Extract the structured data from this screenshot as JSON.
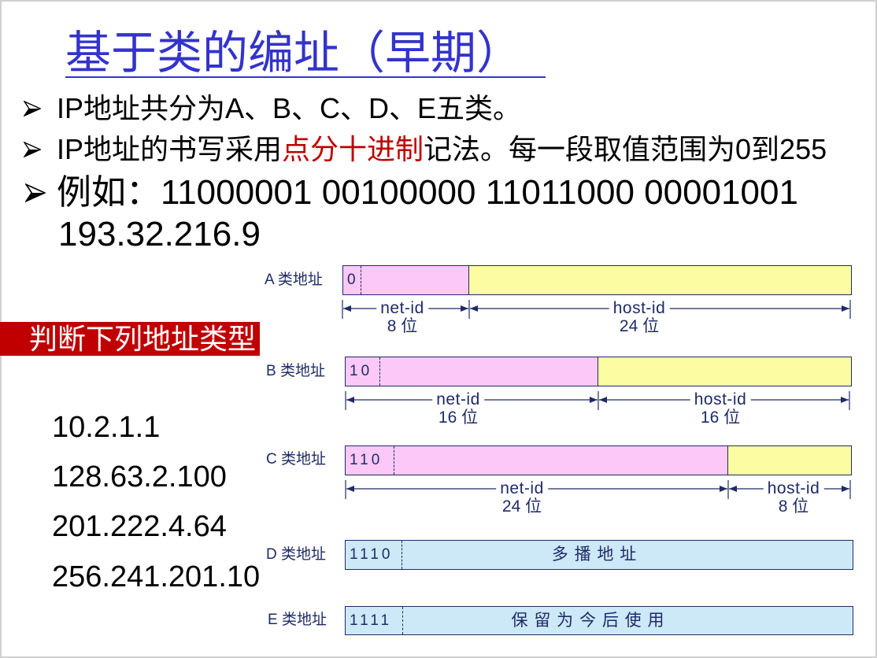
{
  "slide": {
    "title": "基于类的编址（早期）",
    "bullet_icon": "arrowhead-bullet-icon",
    "bullets": [
      {
        "text": "IP地址共分为A、B、C、D、E五类。"
      },
      {
        "text_before": "IP地址的书写采用",
        "highlight": "点分十进制",
        "text_after": "记法。每一段取值范围为0到255"
      },
      {
        "line1": "例如：11000001 00100000 11011000 00001001",
        "line2": "193.32.216.9"
      }
    ]
  },
  "exercise": {
    "banner": "判断下列地址类型",
    "addresses": [
      "10.2.1.1",
      "128.63.2.100",
      "201.222.4.64",
      "256.241.201.10"
    ]
  },
  "address_classes": [
    {
      "label": "A 类地址",
      "prefix": "0",
      "net_id": {
        "name": "net-id",
        "length": "8 位"
      },
      "host_id": {
        "name": "host-id",
        "length": "24 位"
      }
    },
    {
      "label": "B 类地址",
      "prefix": "10",
      "net_id": {
        "name": "net-id",
        "length": "16 位"
      },
      "host_id": {
        "name": "host-id",
        "length": "16 位"
      }
    },
    {
      "label": "C 类地址",
      "prefix": "110",
      "net_id": {
        "name": "net-id",
        "length": "24 位"
      },
      "host_id": {
        "name": "host-id",
        "length": "8 位"
      }
    },
    {
      "label": "D 类地址",
      "prefix": "1110",
      "body": "多 播 地 址"
    },
    {
      "label": "E 类地址",
      "prefix": "1111",
      "body": "保 留 为 今 后 使 用"
    }
  ],
  "colors": {
    "title": "#3333cc",
    "highlight": "#c00000",
    "banner": "#c00000",
    "net_id_field": "#fbc8f7",
    "host_id_field": "#fcfca2",
    "special_field": "#cde9f8",
    "diagram_ink": "#1f2b66"
  }
}
